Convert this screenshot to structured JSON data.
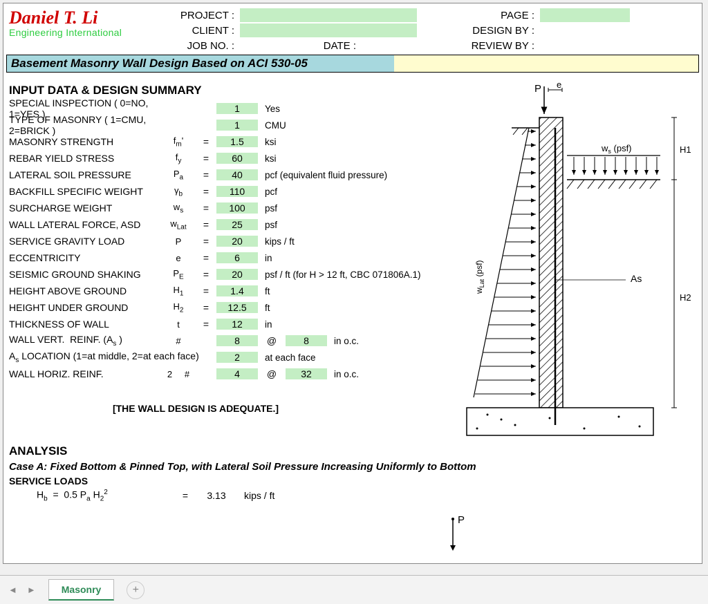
{
  "logo": {
    "name": "Daniel T. Li",
    "subtitle": "Engineering International"
  },
  "meta": {
    "project_lbl": "PROJECT :",
    "client_lbl": "CLIENT :",
    "jobno_lbl": "JOB NO. :",
    "date_lbl": "DATE :",
    "page_lbl": "PAGE :",
    "design_lbl": "DESIGN BY :",
    "review_lbl": "REVIEW BY :"
  },
  "title": "Basement Masonry Wall Design Based on ACI 530-05",
  "section1": "INPUT DATA & DESIGN SUMMARY",
  "rows": [
    {
      "desc": "SPECIAL INSPECTION ( 0=NO, 1=YES )",
      "sym": "",
      "eq": "",
      "val": "1",
      "unit": "Yes"
    },
    {
      "desc": "TYPE OF MASONRY ( 1=CMU, 2=BRICK )",
      "sym": "",
      "eq": "",
      "val": "1",
      "unit": "CMU"
    },
    {
      "desc": "MASONRY STRENGTH",
      "sym": "f_m'",
      "eq": "=",
      "val": "1.5",
      "unit": "ksi"
    },
    {
      "desc": "REBAR YIELD STRESS",
      "sym": "f_y",
      "eq": "=",
      "val": "60",
      "unit": "ksi"
    },
    {
      "desc": "LATERAL SOIL PRESSURE",
      "sym": "P_a",
      "eq": "=",
      "val": "40",
      "unit": "pcf (equivalent fluid pressure)"
    },
    {
      "desc": "BACKFILL SPECIFIC WEIGHT",
      "sym": "γ_b",
      "eq": "=",
      "val": "110",
      "unit": "pcf"
    },
    {
      "desc": "SURCHARGE WEIGHT",
      "sym": "w_s",
      "eq": "=",
      "val": "100",
      "unit": "psf"
    },
    {
      "desc": "WALL LATERAL FORCE, ASD",
      "sym": "w_Lat",
      "eq": "=",
      "val": "25",
      "unit": "psf"
    },
    {
      "desc": "SERVICE GRAVITY LOAD",
      "sym": "P",
      "eq": "=",
      "val": "20",
      "unit": "kips / ft"
    },
    {
      "desc": "ECCENTRICITY",
      "sym": "e",
      "eq": "=",
      "val": "6",
      "unit": "in"
    },
    {
      "desc": "SEISMIC GROUND SHAKING",
      "sym": "P_E",
      "eq": "=",
      "val": "20",
      "unit": "psf / ft (for H > 12 ft, CBC 071806A.1)",
      "tiny": true
    },
    {
      "desc": "HEIGHT ABOVE GROUND",
      "sym": "H_1",
      "eq": "=",
      "val": "1.4",
      "unit": "ft"
    },
    {
      "desc": "HEIGHT UNDER GROUND",
      "sym": "H_2",
      "eq": "=",
      "val": "12.5",
      "unit": "ft"
    },
    {
      "desc": "THICKNESS OF WALL",
      "sym": "t",
      "eq": "=",
      "val": "12",
      "unit": "in"
    }
  ],
  "vert_reinf": {
    "desc": "WALL VERT.  REINF. (A_s )",
    "hash": "#",
    "val": "8",
    "at": "@",
    "val2": "8",
    "unit": "in o.c."
  },
  "as_loc": {
    "desc": "A_s LOCATION (1=at middle, 2=at each face)",
    "val": "2",
    "unit": "at each face"
  },
  "horiz_reinf": {
    "desc": "WALL HORIZ. REINF.",
    "count": "2",
    "hash": "#",
    "val": "4",
    "at": "@",
    "val2": "32",
    "unit": "in o.c."
  },
  "adequate": "[THE WALL DESIGN IS ADEQUATE.]",
  "analysis": {
    "title": "ANALYSIS",
    "case": "Case A: Fixed Bottom & Pinned Top, with Lateral Soil Pressure Increasing Uniformly to Bottom",
    "service": "SERVICE LOADS",
    "formula": {
      "lhs": "Hb  =  0.5 P_a H_2²",
      "eq": "=",
      "val": "3.13",
      "unit": "kips / ft"
    },
    "p_label": "P"
  },
  "diagram": {
    "p": "P",
    "e": "e",
    "ws": "w_s  (psf)",
    "h1": "H1",
    "h2": "H2",
    "as": "As",
    "wlat": "w_Lat (psf)"
  },
  "tabs": {
    "active": "Masonry"
  }
}
